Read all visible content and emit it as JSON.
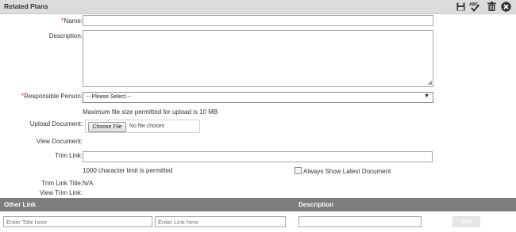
{
  "header": {
    "title": "Related Plans"
  },
  "icons": {
    "save": "save-icon",
    "spellcheck": "spellcheck-icon",
    "delete": "trash-icon",
    "close": "close-circle-icon"
  },
  "colors": {
    "required": "#e0332d",
    "bar": "#7d7d7d",
    "header": "#dcdcdc"
  },
  "form": {
    "required_mark": "*",
    "name_label": "Name:",
    "name_value": "",
    "description_label": "Description:",
    "description_value": "",
    "responsible_label": "Responsible Person:",
    "responsible_selected": "-- Please Select --",
    "max_file_note": "Maximum file size permitted for upload is 10 MB",
    "upload_label": "Upload Document:",
    "choose_file": "Choose File",
    "no_file": "No file chosen",
    "view_document_label": "View Document:",
    "trim_link_label": "Trim Link:",
    "trim_link_value": "",
    "char_limit_note": "1000 character limit is permitted",
    "always_show_label": "Always Show Latest Document",
    "always_show_checked": false,
    "trim_link_title_label": "Trim Link Title:",
    "trim_link_title_value": "N/A",
    "view_trim_link_label": "View Trim Link:"
  },
  "other_link": {
    "header_left": "Other Link",
    "header_right": "Description",
    "title_placeholder": "Enter Title here",
    "link_placeholder": "Enter Link here",
    "description_value": "",
    "add_label": "Add"
  }
}
